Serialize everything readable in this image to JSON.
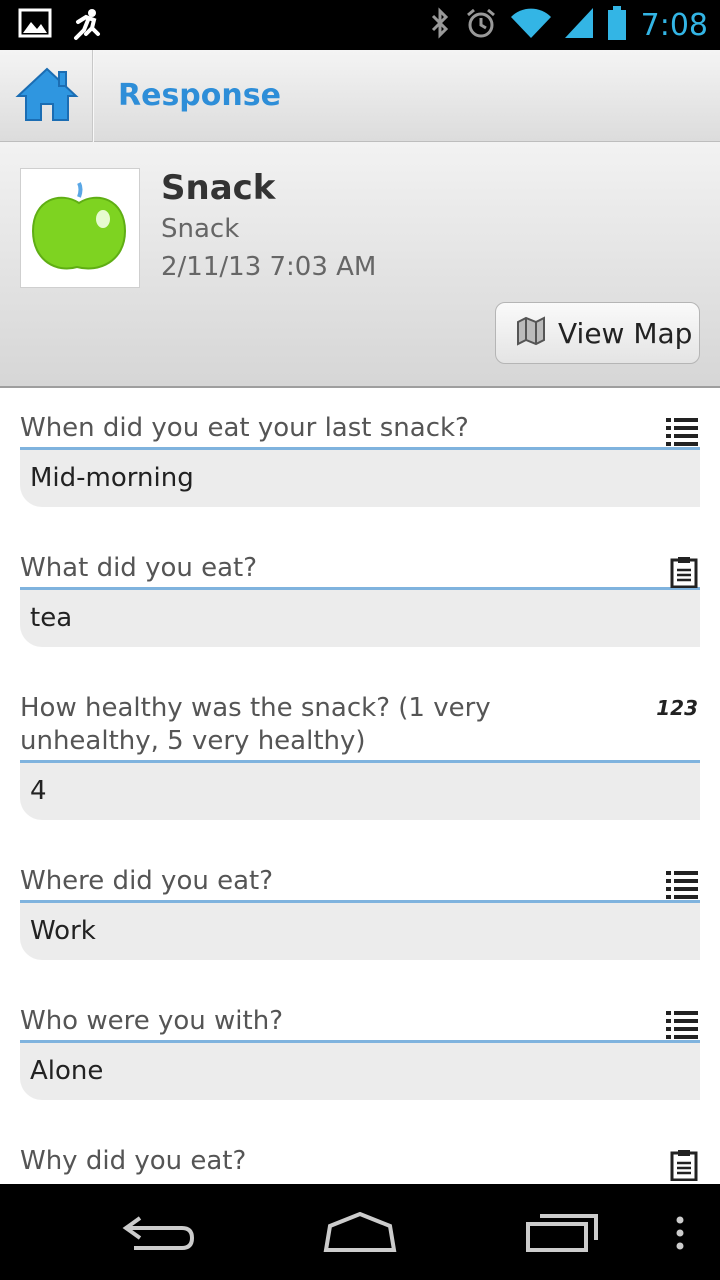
{
  "status_bar": {
    "time": "7:08",
    "left_icons": [
      "picture-icon",
      "runner-icon"
    ],
    "right_icons": [
      "bluetooth-icon",
      "alarm-icon",
      "wifi-icon",
      "signal-icon",
      "battery-icon"
    ]
  },
  "action_bar": {
    "title": "Response",
    "home_icon": "home-icon"
  },
  "header": {
    "title": "Snack",
    "subtitle": "Snack",
    "date": "2/11/13 7:03 AM",
    "thumbnail_icon": "green-apple-icon",
    "map_button_label": "View Map"
  },
  "questions": [
    {
      "text": "When did you eat your last snack?",
      "answer": "Mid-morning",
      "icon": "list-icon"
    },
    {
      "text": "What did you eat?",
      "answer": "tea",
      "icon": "clipboard-icon"
    },
    {
      "text": "How healthy was the snack? (1 very unhealthy, 5 very healthy)",
      "answer": "4",
      "icon": "number-icon",
      "icon_text": "123"
    },
    {
      "text": "Where did you eat?",
      "answer": "Work",
      "icon": "list-icon"
    },
    {
      "text": "Who were you with?",
      "answer": "Alone",
      "icon": "list-icon"
    },
    {
      "text": "Why did you eat?",
      "answer": "",
      "icon": "clipboard-icon"
    }
  ],
  "colors": {
    "accent": "#33b5e5",
    "title_blue": "#2e8ed8",
    "apple_green": "#7ed321"
  }
}
